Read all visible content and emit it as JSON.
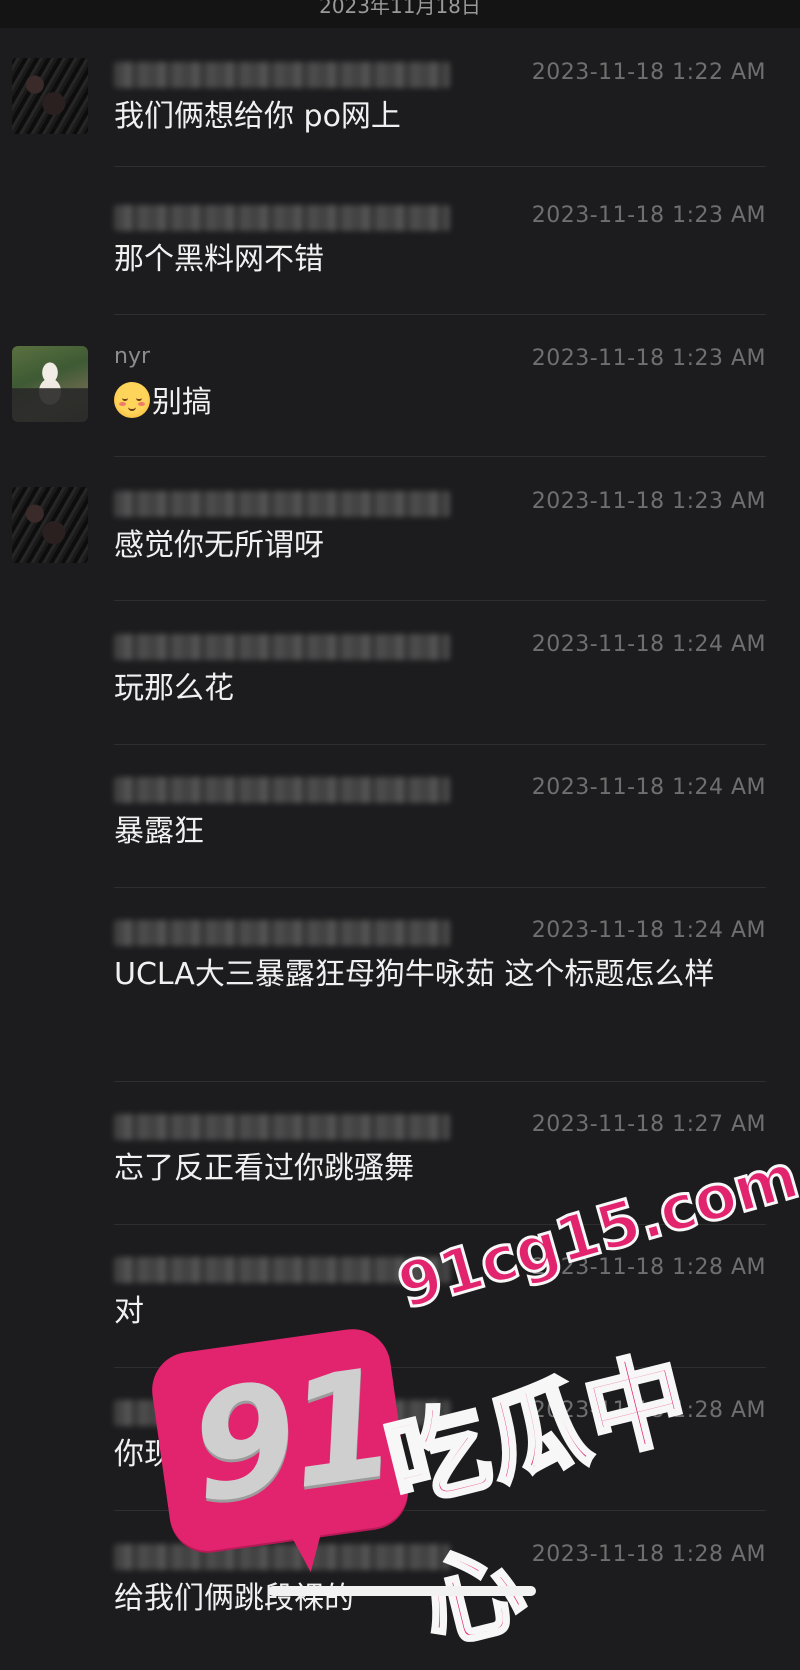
{
  "header": {
    "date": "2023年11月18日"
  },
  "messages": [
    {
      "sender": "",
      "time": "2023-11-18 1:22 AM",
      "text": "我们俩想给你 po网上",
      "avatar": "scribbled"
    },
    {
      "sender": "",
      "time": "2023-11-18 1:23 AM",
      "text": "那个黑料网不错"
    },
    {
      "sender": "nyr",
      "time": "2023-11-18 1:23 AM",
      "text": "别搞",
      "emoji": "smiling-face-emoji",
      "avatar": "photo"
    },
    {
      "sender": "",
      "time": "2023-11-18 1:23 AM",
      "text": "感觉你无所谓呀",
      "avatar": "scribbled"
    },
    {
      "sender": "",
      "time": "2023-11-18 1:24 AM",
      "text": "玩那么花"
    },
    {
      "sender": "",
      "time": "2023-11-18 1:24 AM",
      "text": "暴露狂"
    },
    {
      "sender": "",
      "time": "2023-11-18 1:24 AM",
      "text": "UCLA大三暴露狂母狗牛咏茹 这个标题怎么样"
    },
    {
      "sender": "",
      "time": "2023-11-18 1:27 AM",
      "text": "忘了反正看过你跳骚舞"
    },
    {
      "sender": "",
      "time": "2023-11-18 1:28 AM",
      "text": "对"
    },
    {
      "sender": "",
      "time": "2023-11-18 1:28 AM",
      "text": "你现在"
    },
    {
      "sender": "",
      "time": "2023-11-18 1:28 AM",
      "text": "给我们俩跳段裸的"
    }
  ],
  "watermark": {
    "number": "91",
    "url": "91cg15.com",
    "title": "吃瓜中心"
  },
  "colors": {
    "background": "#1c1c1e",
    "accent": "#e2246f"
  }
}
